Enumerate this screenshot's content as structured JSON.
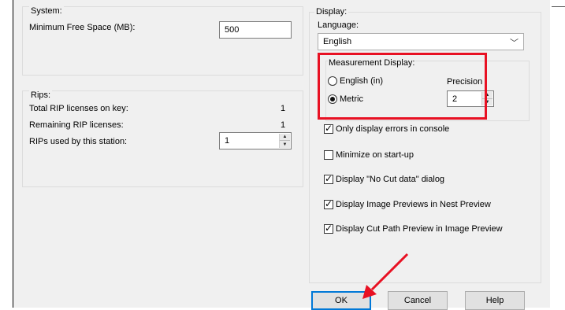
{
  "system": {
    "group_label": "System:",
    "min_free_space_label": "Minimum Free Space (MB):",
    "min_free_space_value": "500"
  },
  "rips": {
    "group_label": "Rips:",
    "total_licenses_label": "Total RIP licenses on key:",
    "total_licenses_value": "1",
    "remaining_licenses_label": "Remaining RIP licenses:",
    "remaining_licenses_value": "1",
    "used_by_station_label": "RIPs used by this station:",
    "used_by_station_value": "1"
  },
  "display": {
    "group_label": "Display:",
    "language_label": "Language:",
    "language_value": "English",
    "measurement": {
      "group_label": "Measurement Display:",
      "english_label": "English (in)",
      "english_checked": false,
      "metric_label": "Metric",
      "metric_checked": true,
      "precision_label": "Precision",
      "precision_value": "2"
    },
    "options": [
      {
        "label": "Only display errors in console",
        "checked": true
      },
      {
        "label": "Minimize on start-up",
        "checked": false
      },
      {
        "label": "Display \"No Cut data\" dialog",
        "checked": true
      },
      {
        "label": "Display Image Previews in Nest Preview",
        "checked": true
      },
      {
        "label": "Display Cut Path Preview in Image Preview",
        "checked": true
      }
    ]
  },
  "buttons": {
    "ok": "OK",
    "cancel": "Cancel",
    "help": "Help"
  },
  "annotation_color": "#e81123",
  "icons": {
    "spin_up": "spin-up-arrow-icon",
    "spin_down": "spin-down-arrow-icon",
    "dropdown": "chevron-down-icon"
  }
}
